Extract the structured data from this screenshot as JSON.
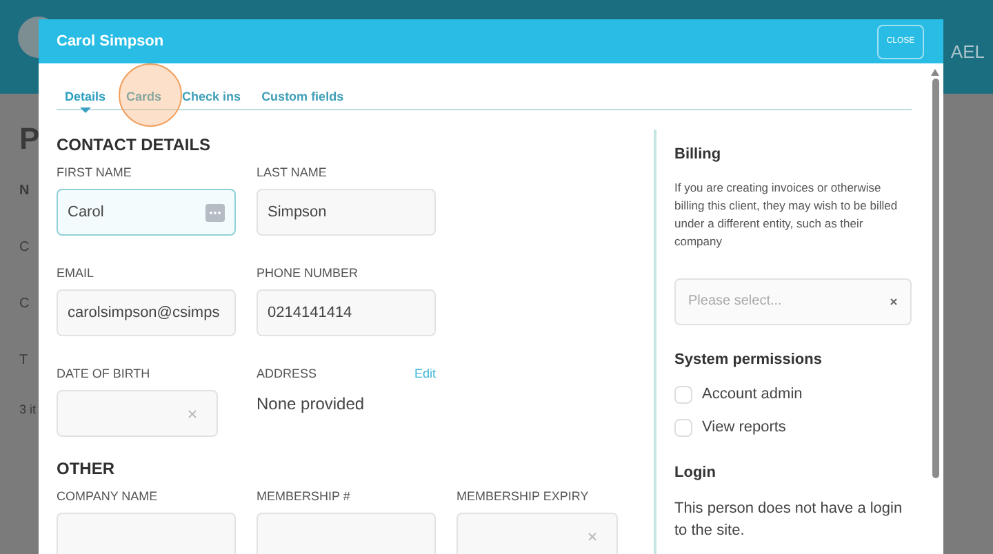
{
  "background": {
    "header_text": "AEL",
    "heading": "P",
    "column_header": "N",
    "rows": [
      "C",
      "C",
      "T"
    ],
    "footer": "3 it"
  },
  "dialog": {
    "title": "Carol Simpson",
    "close_button": "CLOSE",
    "tabs": [
      {
        "label": "Details",
        "selected": true
      },
      {
        "label": "Cards",
        "selected": false
      },
      {
        "label": "Check ins",
        "selected": false
      },
      {
        "label": "Custom fields",
        "selected": false
      }
    ],
    "sections": [
      {
        "title": "CONTACT DETAILS",
        "fields": [
          {
            "kind": "text",
            "label": "FIRST NAME",
            "value": "Carol",
            "focused": true
          },
          {
            "kind": "text",
            "label": "LAST NAME",
            "value": "Simpson",
            "focused": false
          },
          {
            "kind": "spacer"
          },
          {
            "kind": "text",
            "label": "EMAIL",
            "value": "carolsimpson@csimps",
            "focused": false
          },
          {
            "kind": "text",
            "label": "PHONE NUMBER",
            "value": "0214141414",
            "focused": false
          },
          {
            "kind": "spacer"
          },
          {
            "kind": "date",
            "label": "DATE OF BIRTH"
          },
          {
            "kind": "address",
            "label": "ADDRESS",
            "link": "Edit",
            "value": "None provided"
          }
        ]
      },
      {
        "title": "OTHER",
        "fields": [
          {
            "kind": "text",
            "label": "COMPANY NAME",
            "focused": false
          },
          {
            "kind": "text",
            "label": "MEMBERSHIP #",
            "focused": false
          },
          {
            "kind": "date",
            "label": "MEMBERSHIP EXPIRY"
          }
        ]
      }
    ],
    "billing": {
      "title": "Billing",
      "description": "If you are creating invoices or otherwise billing this client, they may wish to be billed under a different entity, such as their company",
      "placeholder": "Please select..."
    },
    "permissions": {
      "title": "System permissions",
      "items": [
        {
          "label": "Account admin",
          "checked": false
        },
        {
          "label": "View reports",
          "checked": false
        }
      ]
    },
    "login": {
      "title": "Login",
      "text": "This person does not have a login to the site."
    }
  }
}
